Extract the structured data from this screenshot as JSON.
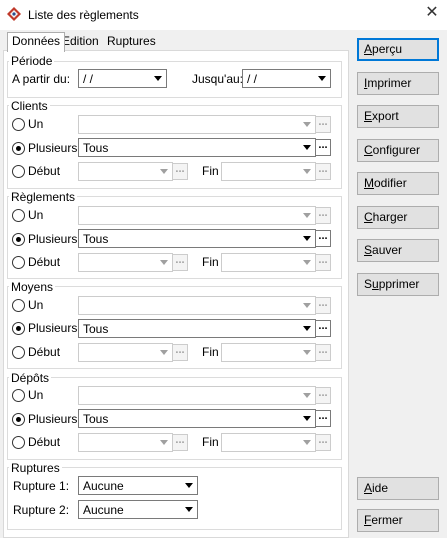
{
  "window": {
    "title": "Liste des règlements"
  },
  "tabs": [
    "Données",
    "Edition",
    "Ruptures"
  ],
  "periode": {
    "label": "Période",
    "from_label": "A partir du:",
    "from_value": " / /",
    "to_label": "Jusqu'au:",
    "to_value": " / /"
  },
  "sections": [
    {
      "label": "Clients",
      "un": "Un",
      "plusieurs": "Plusieurs",
      "plusieurs_value": "Tous",
      "debut": "Début",
      "fin": "Fin"
    },
    {
      "label": "Règlements",
      "un": "Un",
      "plusieurs": "Plusieurs",
      "plusieurs_value": "Tous",
      "debut": "Début",
      "fin": "Fin"
    },
    {
      "label": "Moyens",
      "un": "Un",
      "plusieurs": "Plusieurs",
      "plusieurs_value": "Tous",
      "debut": "Début",
      "fin": "Fin"
    },
    {
      "label": "Dépôts",
      "un": "Un",
      "plusieurs": "Plusieurs",
      "plusieurs_value": "Tous",
      "debut": "Début",
      "fin": "Fin"
    }
  ],
  "ruptures": {
    "label": "Ruptures",
    "r1_label": "Rupture 1:",
    "r1_value": "Aucune",
    "r2_label": "Rupture 2:",
    "r2_value": "Aucune"
  },
  "buttons": {
    "apercu": {
      "accel": "A",
      "rest": "perçu"
    },
    "imprimer": {
      "accel": "I",
      "rest": "mprimer"
    },
    "export": {
      "accel": "E",
      "rest": "xport"
    },
    "configurer": {
      "accel": "C",
      "rest": "onfigurer"
    },
    "modifier": {
      "accel": "M",
      "rest": "odifier"
    },
    "charger": {
      "accel": "C",
      "rest": "harger"
    },
    "sauver": {
      "accel": "S",
      "rest": "auver"
    },
    "supprimer": {
      "pre": "S",
      "accel": "u",
      "rest": "pprimer"
    },
    "aide": {
      "accel": "A",
      "rest": "ide"
    },
    "fermer": {
      "accel": "F",
      "rest": "ermer"
    }
  },
  "icons": {
    "app": "app-logo-icon",
    "close": "close-icon"
  }
}
